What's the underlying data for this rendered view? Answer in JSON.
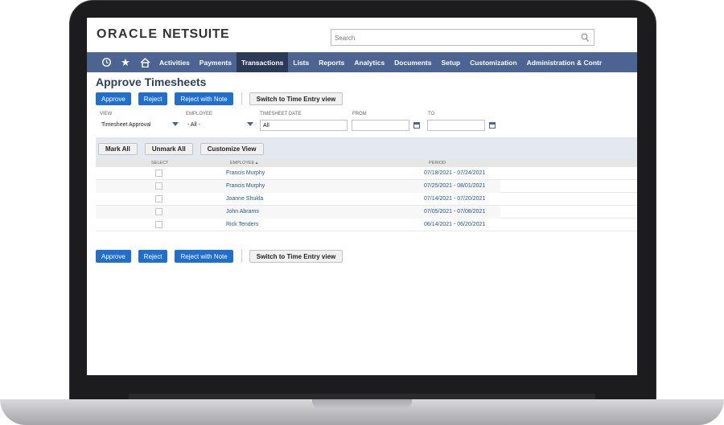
{
  "header": {
    "logo_oracle": "ORACLE",
    "logo_netsuite": "NETSUITE",
    "search_placeholder": "Search",
    "search_icon": "magnifier"
  },
  "nav": {
    "icons": [
      "history-icon",
      "star-icon",
      "home-icon"
    ],
    "items": [
      "Activities",
      "Payments",
      "Transactions",
      "Lists",
      "Reports",
      "Analytics",
      "Documents",
      "Setup",
      "Customization",
      "Administration & Contr"
    ],
    "active": "Transactions",
    "bg_color": "#4b6491",
    "active_color": "#2b3b57"
  },
  "page": {
    "title": "Approve Timesheets",
    "buttons": {
      "approve": "Approve",
      "reject": "Reject",
      "reject_with_note": "Reject with Note",
      "switch_view": "Switch to Time Entry view"
    }
  },
  "filters": {
    "view_label": "VIEW",
    "view_value": "Timesheet Approval",
    "employee_label": "EMPLOYEE",
    "employee_value": "- All -",
    "date_label": "TIMESHEET DATE",
    "date_value": "All",
    "from_label": "FROM",
    "from_value": "",
    "to_label": "TO",
    "to_value": ""
  },
  "list": {
    "mark_all": "Mark All",
    "unmark_all": "Unmark All",
    "customize_view": "Customize View",
    "columns": {
      "select": "SELECT",
      "employee": "EMPLOYEE ▴",
      "period": "PERIOD"
    },
    "rows": [
      {
        "employee": "Francis Murphy",
        "period": "07/18/2021 - 07/24/2021"
      },
      {
        "employee": "Francis Murphy",
        "period": "07/25/2021 - 08/01/2021"
      },
      {
        "employee": "Joanne Shukla",
        "period": "07/14/2021 - 07/20/2021"
      },
      {
        "employee": "John Abrams",
        "period": "07/05/2021 - 07/08/2021"
      },
      {
        "employee": "Rick Tenders",
        "period": "06/14/2021 - 06/20/2021"
      }
    ]
  },
  "colors": {
    "accent_blue": "#1f6fd0",
    "title_color": "#2c4166",
    "link_color": "#22569a"
  }
}
